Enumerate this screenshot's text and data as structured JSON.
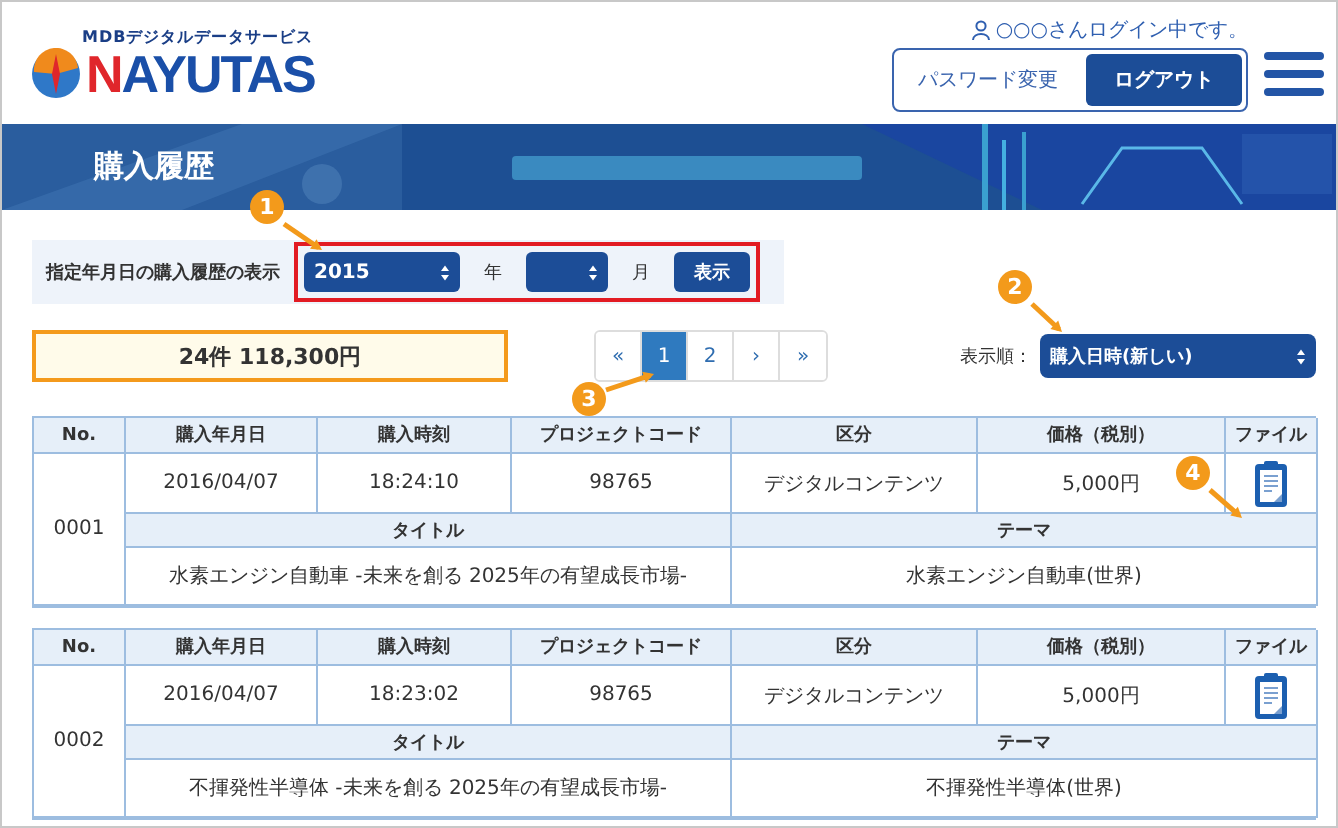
{
  "header": {
    "logo": {
      "tagline": "MDBデジタルデータサービス",
      "name": "NAYUTAS"
    },
    "user_status": "○○○さんログイン中です。",
    "buttons": [
      {
        "label": "パスワード変更",
        "kind": "outline"
      },
      {
        "label": "ログアウト",
        "kind": "primary"
      }
    ]
  },
  "page_title": "購入履歴",
  "filter": {
    "label": "指定年月日の購入履歴の表示",
    "year": "2015",
    "year_unit": "年",
    "month_unit": "月",
    "submit": "表示"
  },
  "summary": "24件 118,300円",
  "pagination": [
    {
      "label": "«",
      "selected": false
    },
    {
      "label": "1",
      "selected": true
    },
    {
      "label": "2",
      "selected": false
    },
    {
      "label": "›",
      "selected": false
    },
    {
      "label": "»",
      "selected": false
    }
  ],
  "sort": {
    "label": "表示順：",
    "value": "購入日時(新しい)"
  },
  "records": [
    {
      "columns": [
        "No.",
        "購入年月日",
        "購入時刻",
        "プロジェクトコード",
        "区分",
        "価格（税別）",
        "ファイル"
      ],
      "no": "0001",
      "date": "2016/04/07",
      "time": "18:24:10",
      "code": "98765",
      "category": "デジタルコンテンツ",
      "price": "5,000円",
      "sub_columns": [
        "タイトル",
        "テーマ"
      ],
      "title": "水素エンジン自動車 -未来を創る 2025年の有望成長市場-",
      "theme": "水素エンジン自動車(世界)"
    },
    {
      "columns": [
        "No.",
        "購入年月日",
        "購入時刻",
        "プロジェクトコード",
        "区分",
        "価格（税別）",
        "ファイル"
      ],
      "no": "0002",
      "date": "2016/04/07",
      "time": "18:23:02",
      "code": "98765",
      "category": "デジタルコンテンツ",
      "price": "5,000円",
      "sub_columns": [
        "タイトル",
        "テーマ"
      ],
      "title": "不揮発性半導体 -未来を創る 2025年の有望成長市場-",
      "theme": "不揮発性半導体(世界)"
    }
  ],
  "annotations": [
    {
      "label": "1"
    },
    {
      "label": "2"
    },
    {
      "label": "3"
    },
    {
      "label": "4"
    }
  ]
}
